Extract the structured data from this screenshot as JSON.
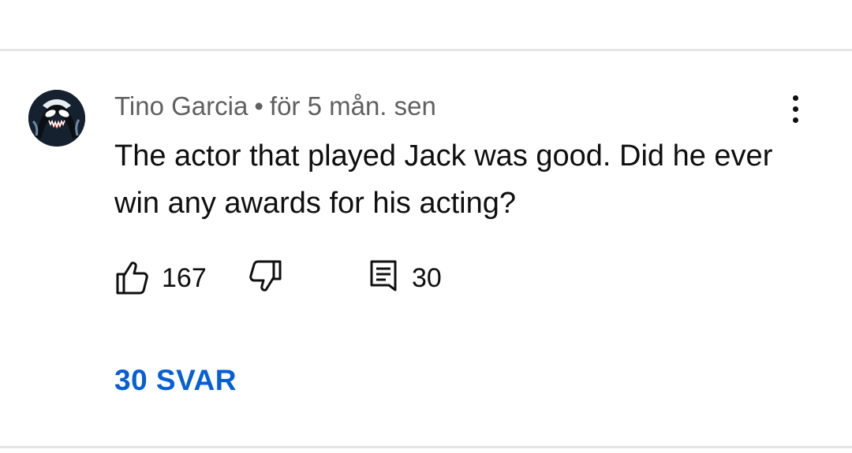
{
  "comment": {
    "author": "Tino Garcia",
    "separator": "•",
    "timestamp": "för 5 mån. sen",
    "text": "The actor that played Jack was good. Did he ever win any awards for his acting?",
    "avatar_icon": "venom-avatar",
    "menu_icon": "more-vert-icon"
  },
  "actions": {
    "like_icon": "thumb-up-icon",
    "like_count": "167",
    "dislike_icon": "thumb-down-icon",
    "reply_icon": "comment-icon",
    "reply_count": "30"
  },
  "replies": {
    "label": "30 SVAR",
    "color": "#065fd4"
  },
  "colors": {
    "meta": "#606060",
    "text": "#0f0f0f",
    "divider": "#e5e5e5"
  }
}
